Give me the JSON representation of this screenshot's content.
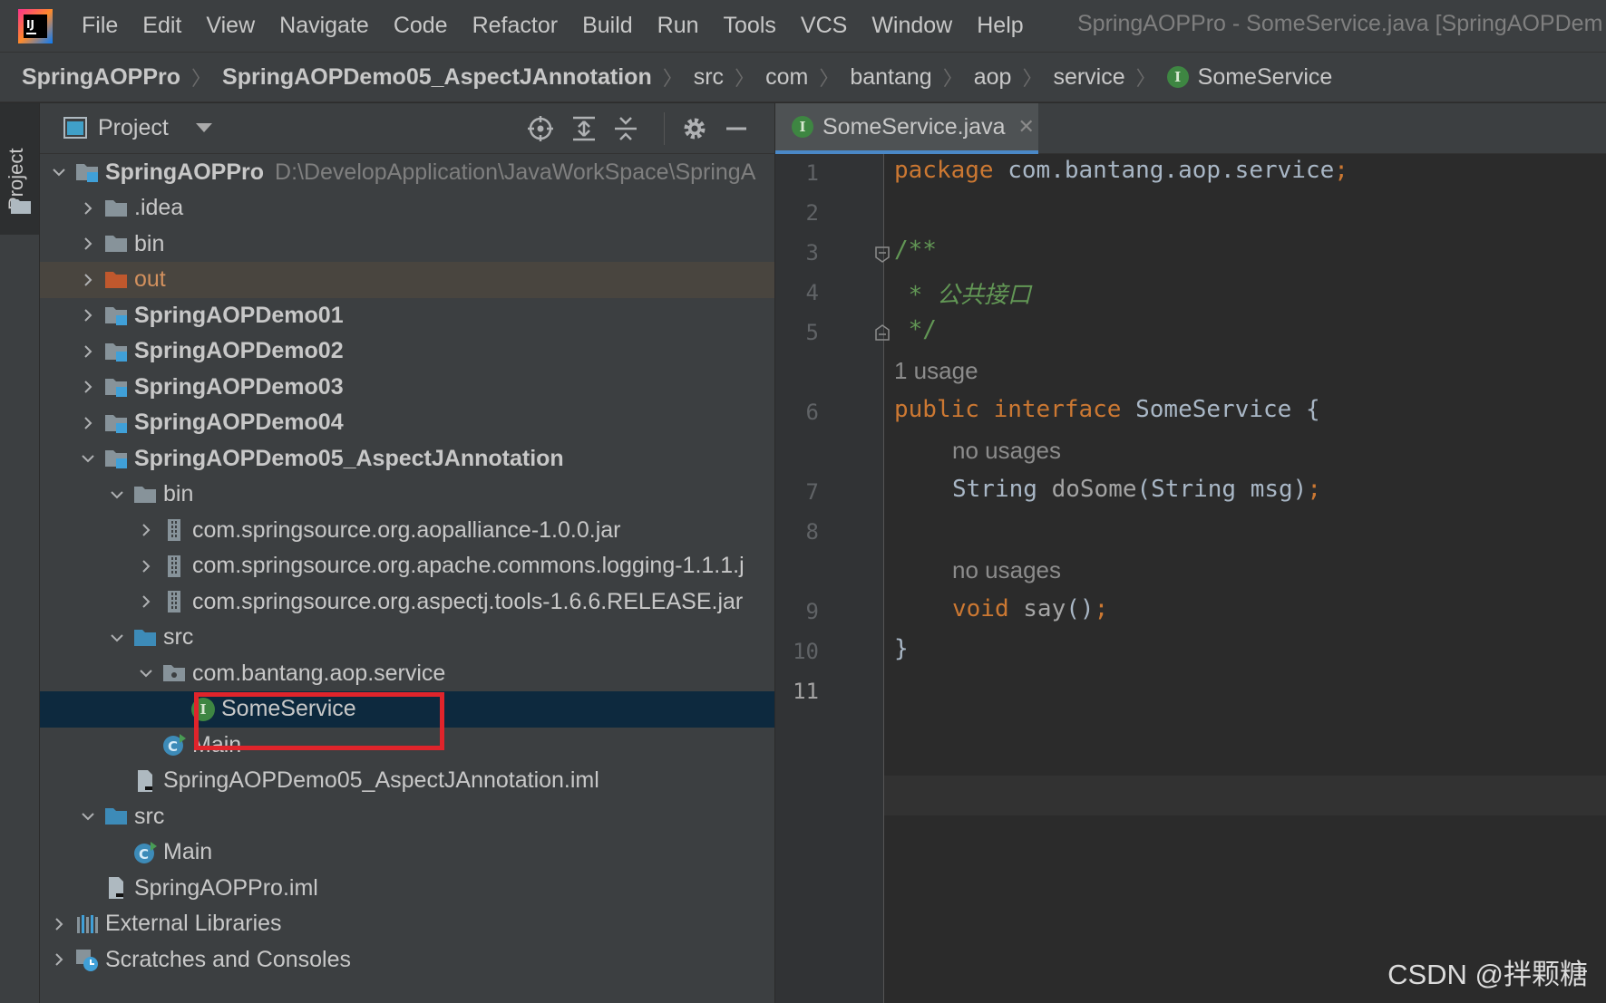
{
  "window_title": "SpringAOPPro - SomeService.java [SpringAOPDem",
  "menu": [
    "File",
    "Edit",
    "View",
    "Navigate",
    "Code",
    "Refactor",
    "Build",
    "Run",
    "Tools",
    "VCS",
    "Window",
    "Help"
  ],
  "breadcrumb": {
    "project": "SpringAOPPro",
    "module": "SpringAOPDemo05_AspectJAnnotation",
    "src": "src",
    "com": "com",
    "bantang": "bantang",
    "aop": "aop",
    "service": "service",
    "file": "SomeService",
    "file_badge": "I"
  },
  "tool_window": {
    "stripe_label": "Project",
    "title": "Project"
  },
  "tree": {
    "root": {
      "label": "SpringAOPPro",
      "path": "D:\\DevelopApplication\\JavaWorkSpace\\SpringA"
    },
    "idea": ".idea",
    "bin": "bin",
    "out": "out",
    "demo01": "SpringAOPDemo01",
    "demo02": "SpringAOPDemo02",
    "demo03": "SpringAOPDemo03",
    "demo04": "SpringAOPDemo04",
    "demo05": "SpringAOPDemo05_AspectJAnnotation",
    "demo05_bin": "bin",
    "jar1": "com.springsource.org.aopalliance-1.0.0.jar",
    "jar2": "com.springsource.org.apache.commons.logging-1.1.1.j",
    "jar3": "com.springsource.org.aspectj.tools-1.6.6.RELEASE.jar",
    "demo05_src": "src",
    "package": "com.bantang.aop.service",
    "someservice": "SomeService",
    "someservice_badge": "I",
    "main_inner": "Main",
    "demo05_iml": "SpringAOPDemo05_AspectJAnnotation.iml",
    "src": "src",
    "main": "Main",
    "main_badge": "C",
    "pro_iml": "SpringAOPPro.iml",
    "ext_libs": "External Libraries",
    "scratches": "Scratches and Consoles"
  },
  "editor": {
    "tab_label": "SomeService.java",
    "tab_close": "✕",
    "tab_badge": "I",
    "line_numbers": [
      "1",
      "2",
      "3",
      "4",
      "5",
      "6",
      "7",
      "8",
      "9",
      "10",
      "11"
    ],
    "code": {
      "l1_kw": "package",
      "l1_rest": " com.bantang.aop.service",
      "l1_semi": ";",
      "l3": "/**",
      "l4_star": " * ",
      "l4_text": "公共接口",
      "l5": " */",
      "hint_usage": "1 usage",
      "l6_kw1": "public",
      "l6_kw2": "interface",
      "l6_name": " SomeService {",
      "hint_no1": "no usages",
      "l7_type": "String ",
      "l7_fn": "doSome",
      "l7_args": "(String msg)",
      "l7_semi": ";",
      "hint_no2": "no usages",
      "l9_kw": "void",
      "l9_fn": "say",
      "l9_paren": "()",
      "l9_semi": ";",
      "l10": "}"
    }
  },
  "watermark": "CSDN @拌颗糖",
  "colors": {
    "keyword": "#cc7832",
    "comment": "#629755",
    "selection": "#0d293e",
    "interface_badge": "#3e8642",
    "highlight_box": "#e0242b"
  }
}
